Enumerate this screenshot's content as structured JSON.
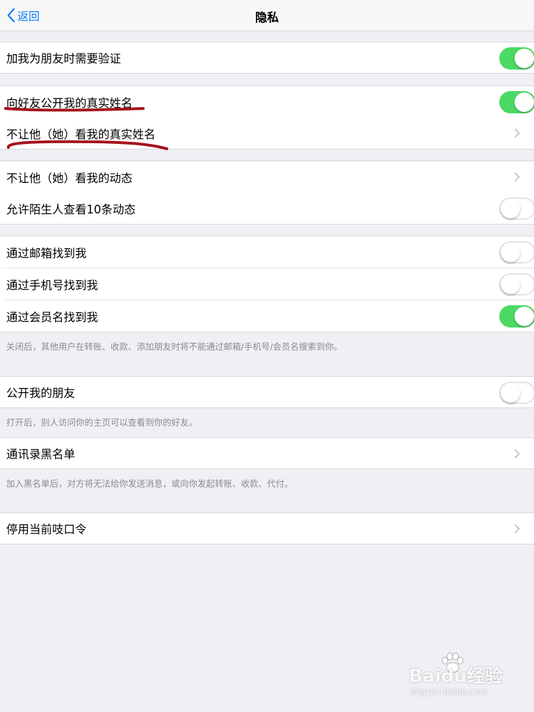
{
  "navbar": {
    "back_label": "返回",
    "title": "隐私"
  },
  "colors": {
    "accent": "#0a7cff",
    "toggle_on": "#4cd964",
    "annotation": "#a6111d"
  },
  "rows": [
    {
      "label": "加我为朋友时需要验证",
      "control": "toggle",
      "state": "on"
    },
    {
      "label": "向好友公开我的真实姓名",
      "control": "toggle",
      "state": "on"
    },
    {
      "label": "不让他（她）看我的真实姓名",
      "control": "chevron"
    },
    {
      "label": "不让他（她）看我的动态",
      "control": "chevron"
    },
    {
      "label": "允许陌生人查看10条动态",
      "control": "toggle",
      "state": "off"
    },
    {
      "label": "通过邮箱找到我",
      "control": "toggle",
      "state": "off"
    },
    {
      "label": "通过手机号找到我",
      "control": "toggle",
      "state": "off"
    },
    {
      "label": "通过会员名找到我",
      "control": "toggle",
      "state": "on"
    },
    {
      "label": "公开我的朋友",
      "control": "toggle",
      "state": "off"
    },
    {
      "label": "通讯录黑名单",
      "control": "chevron"
    },
    {
      "label": "停用当前吱口令",
      "control": "chevron"
    }
  ],
  "footers": {
    "search": "关闭后，其他用户在转账、收款、添加朋友时将不能通过邮箱/手机号/会员名搜索到你。",
    "friends": "打开后，别人访问你的主页可以查看到你的好友。",
    "blacklist": "加入黑名单后，对方将无法给你发送消息，或向你发起转账、收款、代付。"
  },
  "watermark": {
    "main": "Baidu经验",
    "sub": "jingyan.baidu.com"
  }
}
